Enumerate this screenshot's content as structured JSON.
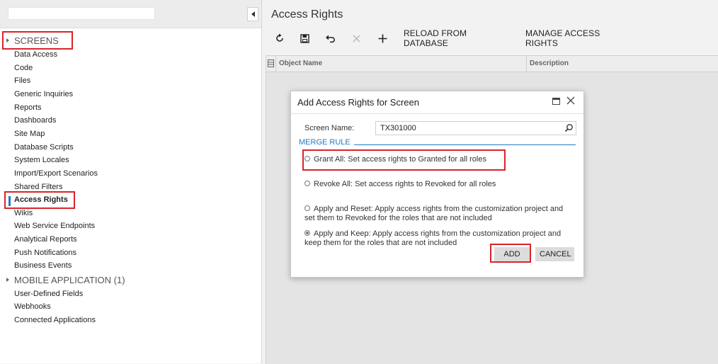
{
  "sidebar": {
    "search_value": "",
    "groups": {
      "screens": "SCREENS",
      "mobile": "MOBILE APPLICATION (1)"
    },
    "screen_items": [
      "Data Access",
      "Code",
      "Files",
      "Generic Inquiries",
      "Reports",
      "Dashboards",
      "Site Map",
      "Database Scripts",
      "System Locales",
      "Import/Export Scenarios",
      "Shared Filters",
      "Access Rights",
      "Wikis",
      "Web Service Endpoints",
      "Analytical Reports",
      "Push Notifications",
      "Business Events"
    ],
    "active_item": "Access Rights",
    "bottom_items": [
      "User-Defined Fields",
      "Webhooks",
      "Connected Applications"
    ]
  },
  "main": {
    "title": "Access Rights",
    "toolbar": {
      "refresh_icon": "refresh-icon",
      "save_icon": "save-icon",
      "undo_icon": "undo-icon",
      "delete_icon": "delete-icon",
      "add_icon": "add-icon",
      "reload_label": "RELOAD FROM DATABASE",
      "manage_label": "MANAGE ACCESS RIGHTS"
    },
    "grid": {
      "columns": [
        "Object Name",
        "Description"
      ]
    }
  },
  "dialog": {
    "title": "Add Access Rights for Screen",
    "screen_name_label": "Screen Name:",
    "screen_name_value": "TX301000",
    "merge_rule_label": "MERGE RULE",
    "options": [
      {
        "line1": "Grant All: Set access rights to Granted for all roles",
        "checked": false
      },
      {
        "line1": "Revoke All: Set access rights to Revoked for all roles",
        "checked": false
      },
      {
        "line1": "Apply and Reset: Apply access rights from the customization project and",
        "line2": "set them to Revoked for the roles that are not included",
        "checked": false
      },
      {
        "line1": "Apply and Keep: Apply access rights from the customization project and",
        "line2": "keep them for the roles that are not included",
        "checked": true
      }
    ],
    "add_label": "ADD",
    "cancel_label": "CANCEL"
  },
  "colors": {
    "accent": "#1f7bc0",
    "highlight": "#d8242a"
  }
}
